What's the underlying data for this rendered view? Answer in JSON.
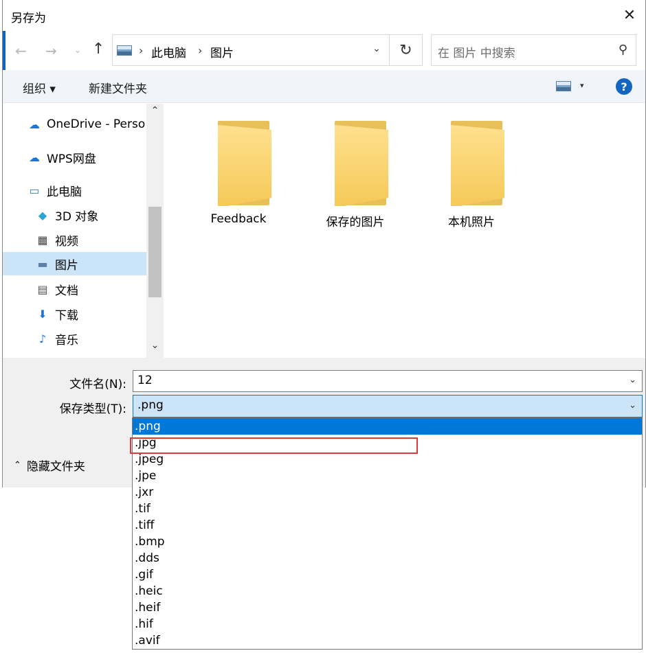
{
  "window": {
    "title": "另存为",
    "close_label": "✕"
  },
  "nav": {
    "back": "←",
    "forward": "→",
    "recent": "⌄",
    "up": "↑",
    "breadcrumb": [
      "此电脑",
      "图片"
    ],
    "refresh": "↻",
    "search_placeholder": "在 图片 中搜索",
    "search_icon": "⚲"
  },
  "toolbar": {
    "organize_label": "组织 ▾",
    "new_folder_label": "新建文件夹",
    "view_drop": "▾",
    "help_label": "?"
  },
  "sidebar": {
    "items": [
      {
        "label": "OneDrive - Perso",
        "icon": "cloud-icon"
      },
      {
        "label": "WPS网盘",
        "icon": "cloud-icon"
      },
      {
        "label": "此电脑",
        "icon": "computer-icon"
      },
      {
        "label": "3D 对象",
        "icon": "cube-icon"
      },
      {
        "label": "视频",
        "icon": "film-icon"
      },
      {
        "label": "图片",
        "icon": "picture-icon",
        "selected": true
      },
      {
        "label": "文档",
        "icon": "document-icon"
      },
      {
        "label": "下载",
        "icon": "download-icon"
      },
      {
        "label": "音乐",
        "icon": "music-icon"
      }
    ]
  },
  "content": {
    "folders": [
      {
        "name": "Feedback"
      },
      {
        "name": "保存的图片"
      },
      {
        "name": "本机照片"
      }
    ]
  },
  "form": {
    "filename_label": "文件名(N):",
    "filename_value": "12",
    "type_label": "保存类型(T):",
    "type_value": ".png",
    "hide_folders_label": "隐藏文件夹"
  },
  "dropdown": {
    "options": [
      ".png",
      ".jpg",
      ".jpeg",
      ".jpe",
      ".jxr",
      ".tif",
      ".tiff",
      ".bmp",
      ".dds",
      ".gif",
      ".heic",
      ".heif",
      ".hif",
      ".avif"
    ],
    "selected_index": 0,
    "highlighted_index": 1
  },
  "colors": {
    "accent": "#0078d7",
    "selection": "#cce4f7",
    "highlight_box": "#e0363d",
    "folder": "#f5c957"
  }
}
